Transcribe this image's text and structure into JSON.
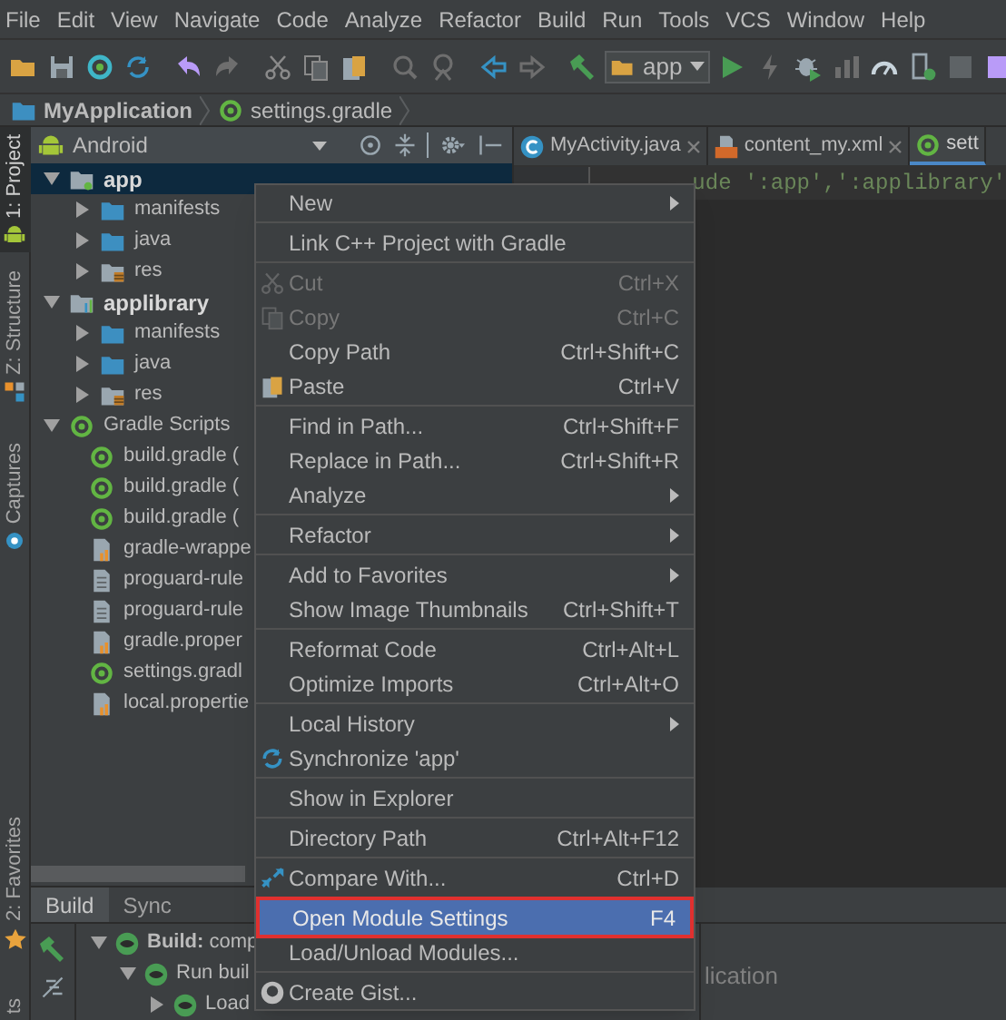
{
  "menu_bar": [
    "File",
    "Edit",
    "View",
    "Navigate",
    "Code",
    "Analyze",
    "Refactor",
    "Build",
    "Run",
    "Tools",
    "VCS",
    "Window",
    "Help"
  ],
  "toolbar": {
    "run_config": "app"
  },
  "breadcrumb": [
    "MyApplication",
    "settings.gradle"
  ],
  "tool_strip_top": [
    {
      "label": "1: Project",
      "selected": true
    },
    {
      "label": "Z: Structure",
      "selected": false
    },
    {
      "label": "Captures",
      "selected": false
    }
  ],
  "tool_strip_bottom": [
    {
      "label": "2: Favorites",
      "selected": false
    },
    {
      "label": "ts",
      "selected": false
    }
  ],
  "project_panel": {
    "view": "Android",
    "tree": [
      {
        "label": "app",
        "kind": "module",
        "bold": true,
        "expanded": true,
        "selected": true,
        "children": [
          {
            "label": "manifests",
            "kind": "folder",
            "expanded": false,
            "selected": false
          },
          {
            "label": "java",
            "kind": "folder",
            "expanded": false,
            "selected": false
          },
          {
            "label": "res",
            "kind": "res",
            "expanded": false,
            "selected": false
          }
        ]
      },
      {
        "label": "applibrary",
        "kind": "library",
        "bold": true,
        "expanded": true,
        "selected": false,
        "children": [
          {
            "label": "manifests",
            "kind": "folder",
            "expanded": false,
            "selected": false
          },
          {
            "label": "java",
            "kind": "folder",
            "expanded": false,
            "selected": false
          },
          {
            "label": "res",
            "kind": "res",
            "expanded": false,
            "selected": false
          }
        ]
      },
      {
        "label": "Gradle Scripts",
        "kind": "gradle",
        "bold": false,
        "expanded": true,
        "selected": false,
        "children": [
          {
            "label": "build.gradle (",
            "kind": "gradle",
            "selected": false
          },
          {
            "label": "build.gradle (",
            "kind": "gradle",
            "selected": false
          },
          {
            "label": "build.gradle (",
            "kind": "gradle",
            "selected": false
          },
          {
            "label": "gradle-wrappe",
            "kind": "properties",
            "selected": false
          },
          {
            "label": "proguard-rule",
            "kind": "text",
            "selected": false
          },
          {
            "label": "proguard-rule",
            "kind": "text",
            "selected": false
          },
          {
            "label": "gradle.proper",
            "kind": "properties",
            "selected": false
          },
          {
            "label": "settings.gradl",
            "kind": "gradle",
            "selected": false
          },
          {
            "label": "local.propertie",
            "kind": "properties",
            "selected": false
          }
        ]
      }
    ]
  },
  "editor": {
    "tabs": [
      {
        "label": "MyActivity.java",
        "kind": "java",
        "selected": false,
        "closable": true
      },
      {
        "label": "content_my.xml",
        "kind": "xml",
        "selected": false,
        "closable": true
      },
      {
        "label": "sett",
        "kind": "gradle",
        "selected": true,
        "closable": false
      }
    ],
    "code_line": "ude ':app',':applibrary'"
  },
  "context_menu": {
    "groups": [
      [
        {
          "label": "New",
          "submenu": true,
          "disabled": false,
          "selected": false,
          "outlined": false
        }
      ],
      [
        {
          "label": "Link C++ Project with Gradle",
          "submenu": false,
          "disabled": false,
          "selected": false,
          "outlined": false
        }
      ],
      [
        {
          "label": "Cut",
          "shortcut": "Ctrl+X",
          "submenu": false,
          "disabled": true,
          "selected": false,
          "outlined": false
        },
        {
          "label": "Copy",
          "shortcut": "Ctrl+C",
          "submenu": false,
          "disabled": true,
          "selected": false,
          "outlined": false
        },
        {
          "label": "Copy Path",
          "shortcut": "Ctrl+Shift+C",
          "submenu": false,
          "disabled": false,
          "selected": false,
          "outlined": false
        },
        {
          "label": "Paste",
          "shortcut": "Ctrl+V",
          "submenu": false,
          "disabled": false,
          "selected": false,
          "outlined": false
        }
      ],
      [
        {
          "label": "Find in Path...",
          "shortcut": "Ctrl+Shift+F",
          "submenu": false,
          "disabled": false,
          "selected": false,
          "outlined": false
        },
        {
          "label": "Replace in Path...",
          "shortcut": "Ctrl+Shift+R",
          "submenu": false,
          "disabled": false,
          "selected": false,
          "outlined": false
        },
        {
          "label": "Analyze",
          "submenu": true,
          "disabled": false,
          "selected": false,
          "outlined": false
        }
      ],
      [
        {
          "label": "Refactor",
          "submenu": true,
          "disabled": false,
          "selected": false,
          "outlined": false
        }
      ],
      [
        {
          "label": "Add to Favorites",
          "submenu": true,
          "disabled": false,
          "selected": false,
          "outlined": false
        },
        {
          "label": "Show Image Thumbnails",
          "shortcut": "Ctrl+Shift+T",
          "submenu": false,
          "disabled": false,
          "selected": false,
          "outlined": false
        }
      ],
      [
        {
          "label": "Reformat Code",
          "shortcut": "Ctrl+Alt+L",
          "submenu": false,
          "disabled": false,
          "selected": false,
          "outlined": false
        },
        {
          "label": "Optimize Imports",
          "shortcut": "Ctrl+Alt+O",
          "submenu": false,
          "disabled": false,
          "selected": false,
          "outlined": false
        }
      ],
      [
        {
          "label": "Local History",
          "submenu": true,
          "disabled": false,
          "selected": false,
          "outlined": false
        },
        {
          "label": "Synchronize 'app'",
          "submenu": false,
          "disabled": false,
          "selected": false,
          "outlined": false
        }
      ],
      [
        {
          "label": "Show in Explorer",
          "submenu": false,
          "disabled": false,
          "selected": false,
          "outlined": false
        }
      ],
      [
        {
          "label": "Directory Path",
          "shortcut": "Ctrl+Alt+F12",
          "submenu": false,
          "disabled": false,
          "selected": false,
          "outlined": false
        }
      ],
      [
        {
          "label": "Compare With...",
          "shortcut": "Ctrl+D",
          "submenu": false,
          "disabled": false,
          "selected": false,
          "outlined": false
        }
      ],
      [
        {
          "label": "Open Module Settings",
          "shortcut": "F4",
          "submenu": false,
          "disabled": false,
          "selected": true,
          "outlined": true
        },
        {
          "label": "Load/Unload Modules...",
          "submenu": false,
          "disabled": false,
          "selected": false,
          "outlined": false
        }
      ],
      [
        {
          "label": "Create Gist...",
          "submenu": false,
          "disabled": false,
          "selected": false,
          "outlined": false
        }
      ]
    ]
  },
  "build_panel": {
    "tabs": [
      {
        "label": "Build",
        "selected": true
      },
      {
        "label": "Sync",
        "selected": false
      }
    ],
    "tree": [
      {
        "label": "**Build:** comp",
        "expanded": true,
        "children": [
          {
            "label": "Run buil",
            "expanded": true,
            "children": [
              {
                "label": "Load",
                "expanded": false
              }
            ]
          }
        ]
      }
    ],
    "output_text": "lication"
  }
}
